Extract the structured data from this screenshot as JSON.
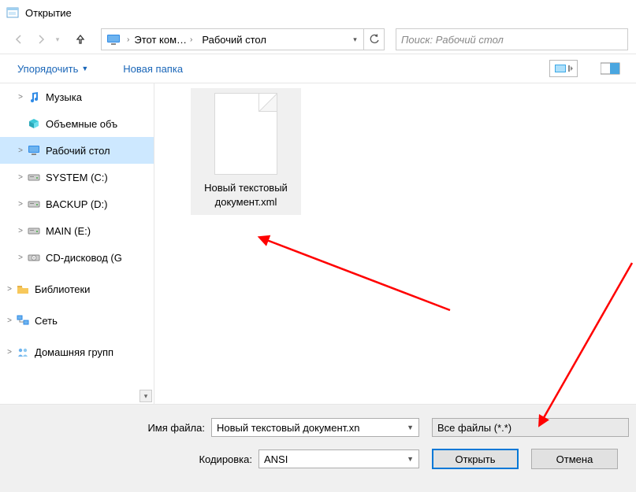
{
  "window": {
    "title": "Открытие"
  },
  "nav": {
    "crumbs": [
      "Этот ком…",
      "Рабочий стол"
    ],
    "search_placeholder": "Поиск: Рабочий стол"
  },
  "toolbar": {
    "organize": "Упорядочить",
    "new_folder": "Новая папка"
  },
  "tree": {
    "items": [
      {
        "label": "Музыка",
        "level": 2,
        "exp": ">",
        "icon": "music"
      },
      {
        "label": "Объемные объ",
        "level": 2,
        "exp": "",
        "icon": "cube"
      },
      {
        "label": "Рабочий стол",
        "level": 2,
        "exp": ">",
        "icon": "desktop",
        "selected": true
      },
      {
        "label": "SYSTEM (C:)",
        "level": 2,
        "exp": ">",
        "icon": "drive"
      },
      {
        "label": "BACKUP (D:)",
        "level": 2,
        "exp": ">",
        "icon": "drive"
      },
      {
        "label": "MAIN (E:)",
        "level": 2,
        "exp": ">",
        "icon": "drive"
      },
      {
        "label": "CD-дисковод (G",
        "level": 2,
        "exp": ">",
        "icon": "cd"
      },
      {
        "label": "Библиотеки",
        "level": 1,
        "exp": ">",
        "icon": "lib"
      },
      {
        "label": "Сеть",
        "level": 1,
        "exp": ">",
        "icon": "net"
      },
      {
        "label": "Домашняя групп",
        "level": 1,
        "exp": ">",
        "icon": "home"
      }
    ]
  },
  "content": {
    "file": "Новый текстовый документ.xml"
  },
  "bottom": {
    "filename_label": "Имя файла:",
    "filename_value": "Новый текстовый документ.xn",
    "encoding_label": "Кодировка:",
    "encoding_value": "ANSI",
    "filter_value": "Все файлы  (*.*)",
    "open": "Открыть",
    "cancel": "Отмена"
  }
}
